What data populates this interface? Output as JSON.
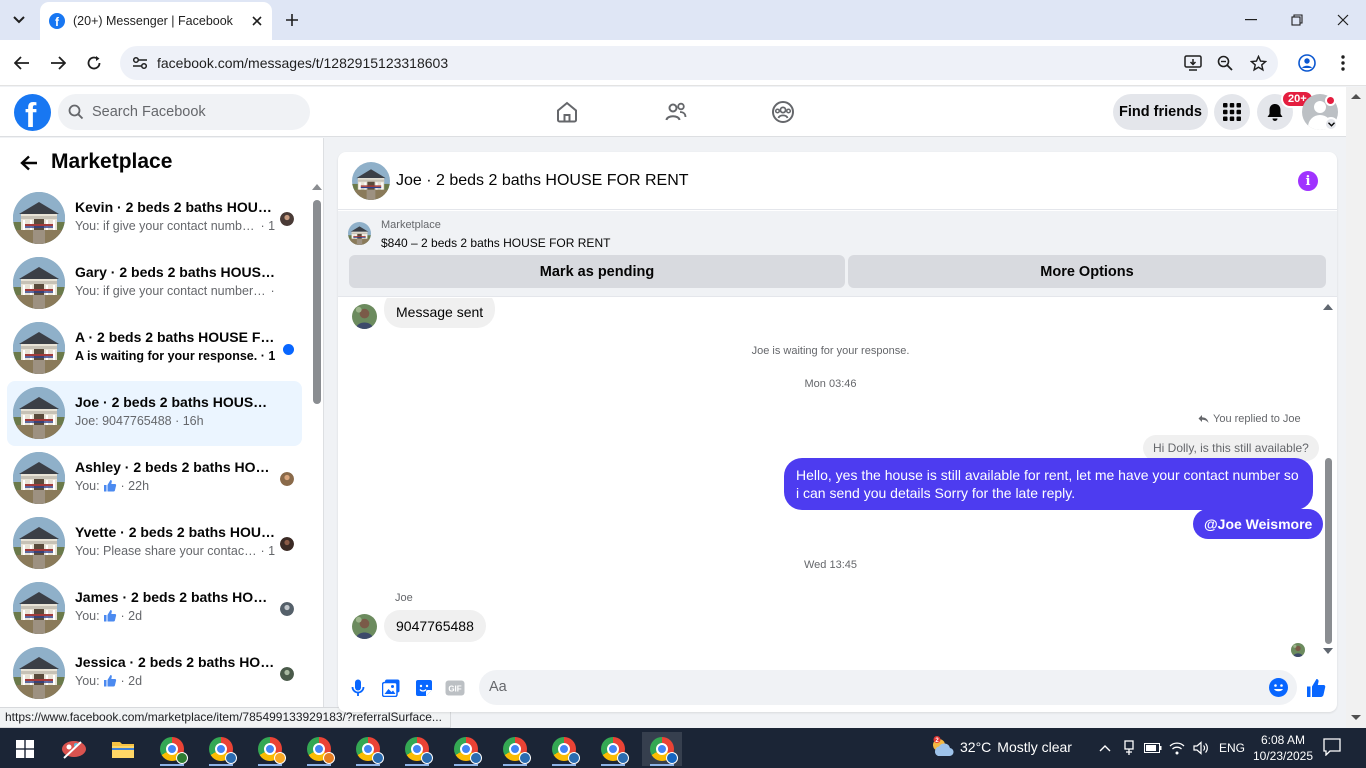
{
  "browser": {
    "tab_title": "(20+) Messenger | Facebook",
    "url": "facebook.com/messages/t/1282915123318603",
    "status_url": "https://www.facebook.com/marketplace/item/785499133929183/?referralSurface..."
  },
  "fb_header": {
    "search_placeholder": "Search Facebook",
    "find_friends": "Find friends",
    "notification_badge": "20+",
    "nav_icons": [
      "home-icon",
      "friends-icon",
      "groups-icon"
    ],
    "right_icons": [
      "menu-grid-icon",
      "bell-icon",
      "profile-avatar"
    ]
  },
  "sidebar": {
    "title": "Marketplace",
    "conversations": [
      {
        "name": "Kevin · 2 beds 2 baths HOUSE FOR RENT",
        "preview": "You: if give your contact number so i can send you details",
        "time": "1h",
        "unread": false
      },
      {
        "name": "Gary · 2 beds 2 baths HOUSE FOR RENT",
        "preview": "You: if give your contact number so i can send you details",
        "time": "1h",
        "unread": false
      },
      {
        "name": "A · 2 beds 2 baths HOUSE FOR RENT",
        "preview": "A is waiting for your response.",
        "time": "11h",
        "unread": true
      },
      {
        "name": "Joe · 2 beds 2 baths HOUSE FOR RENT",
        "preview": "Joe: 9047765488",
        "time": "16h",
        "unread": false,
        "active": true
      },
      {
        "name": "Ashley · 2 beds 2 baths HOUSE FOR RENT",
        "preview": "You:",
        "time": "22h",
        "like": true
      },
      {
        "name": "Yvette · 2 beds 2 baths HOUSE FOR RENT",
        "preview": "You: Please share your contact number",
        "time": "1d"
      },
      {
        "name": "James · 2 beds 2 baths HOUSE FOR RENT",
        "preview": "You:",
        "time": "2d",
        "like": true
      },
      {
        "name": "Jessica · 2 beds 2 baths HOUSE FOR RENT",
        "preview": "You:",
        "time": "2d",
        "like": true
      }
    ]
  },
  "chat": {
    "title": "Joe · 2 beds 2 baths HOUSE FOR RENT",
    "marketplace_label": "Marketplace",
    "item": "$840 – 2 beds 2 baths HOUSE FOR RENT",
    "btn_pending": "Mark as pending",
    "btn_more": "More Options",
    "messages": {
      "sent_notice": "Message sent",
      "waiting": "Joe is waiting for your response.",
      "time1": "Mon 03:46",
      "replied_to": "You replied to Joe",
      "quoted": "Hi Dolly, is this still available?",
      "reply": "Hello, yes the house is still available for rent, let me have your contact number so i can send you details Sorry for the late reply.",
      "mention": "@Joe Weismore",
      "time2": "Wed 13:45",
      "sender": "Joe",
      "incoming": "9047765488"
    },
    "composer_placeholder": "Aa",
    "composer_icons": [
      "microphone-icon",
      "photo-icon",
      "sticker-icon",
      "gif-icon",
      "emoji-icon",
      "like-icon"
    ]
  },
  "taskbar": {
    "weather_temp": "32°C",
    "weather_desc": "Mostly clear",
    "weather_badge": "2",
    "language": "ENG",
    "time": "6:08 AM",
    "date": "10/23/2025"
  },
  "colors": {
    "fb_blue": "#1877f2",
    "bubble_out": "#4d3cf0",
    "info": "#a033ff",
    "taskbar": "#1b2536"
  }
}
